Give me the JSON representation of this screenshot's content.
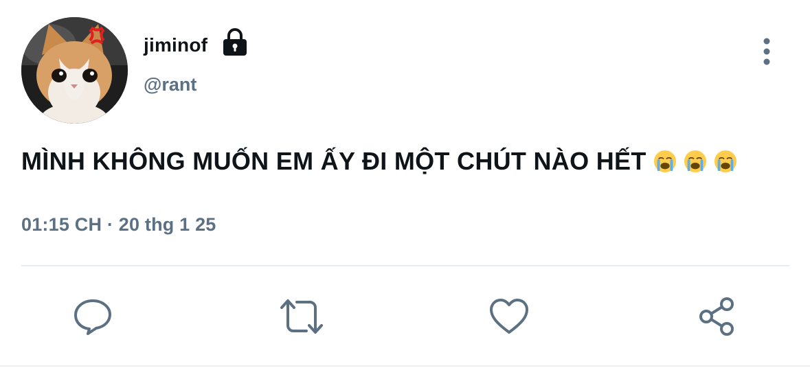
{
  "user": {
    "display_name": "jiminof",
    "handle": "@rant"
  },
  "tweet": {
    "text": "MÌNH KHÔNG MUỐN EM ẤY ĐI MỘT CHÚT NÀO HẾT",
    "emojis": [
      "loudly-crying-face",
      "loudly-crying-face",
      "loudly-crying-face"
    ],
    "timestamp": "01:15 CH · 20 thg 1 25"
  },
  "icons": {
    "lock": "lock-icon",
    "more": "more-vertical-icon",
    "reply": "reply-icon",
    "retweet": "retweet-icon",
    "like": "heart-icon",
    "share": "share-icon"
  },
  "colors": {
    "text_primary": "#0f1419",
    "text_secondary": "#5b7083",
    "icon": "#5b7083",
    "divider": "#e6ecf0"
  }
}
